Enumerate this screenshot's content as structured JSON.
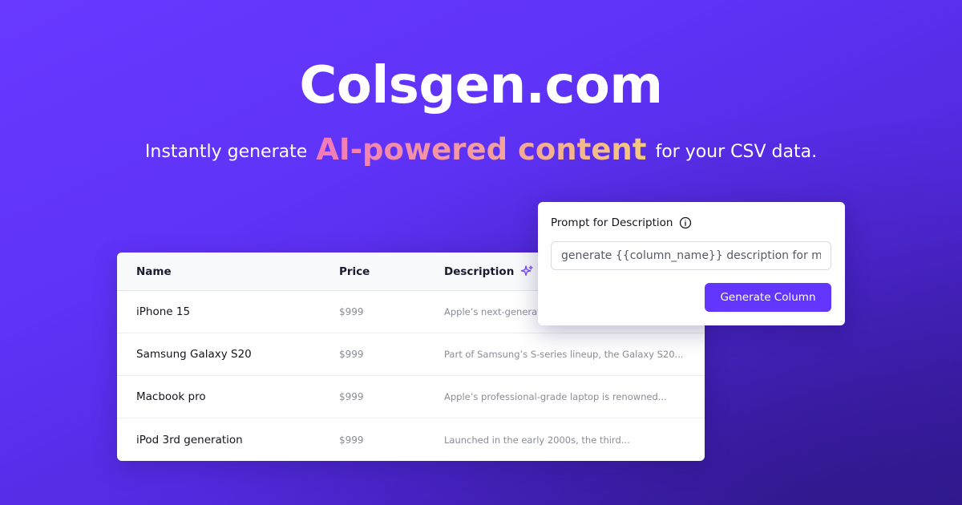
{
  "hero": {
    "title": "Colsgen.com",
    "tagline_prefix": "Instantly generate",
    "tagline_highlight": "AI-powered content",
    "tagline_suffix": "for your CSV data."
  },
  "table": {
    "headers": {
      "name": "Name",
      "price": "Price",
      "description": "Description"
    },
    "rows": [
      {
        "name": "iPhone 15",
        "price": "$999",
        "description": "Apple’s next-generation"
      },
      {
        "name": "Samsung Galaxy S20",
        "price": "$999",
        "description": "Part of Samsung’s S-series lineup, the Galaxy S20..."
      },
      {
        "name": "Macbook pro",
        "price": "$999",
        "description": "Apple’s professional-grade laptop is renowned..."
      },
      {
        "name": "iPod 3rd generation",
        "price": "$999",
        "description": "Launched in the early 2000s, the third..."
      }
    ]
  },
  "prompt": {
    "label": "Prompt for Description",
    "input_value": "generate {{column_name}} description for me",
    "button_label": "Generate Column"
  },
  "colors": {
    "brand": "#6236ff",
    "background_start": "#6838ff",
    "background_end": "#351a9a",
    "highlight_gradient": [
      "#f27ab8",
      "#f5c87c"
    ]
  },
  "icons": {
    "description_header": "sparkle-icon",
    "prompt_label": "info-icon"
  }
}
